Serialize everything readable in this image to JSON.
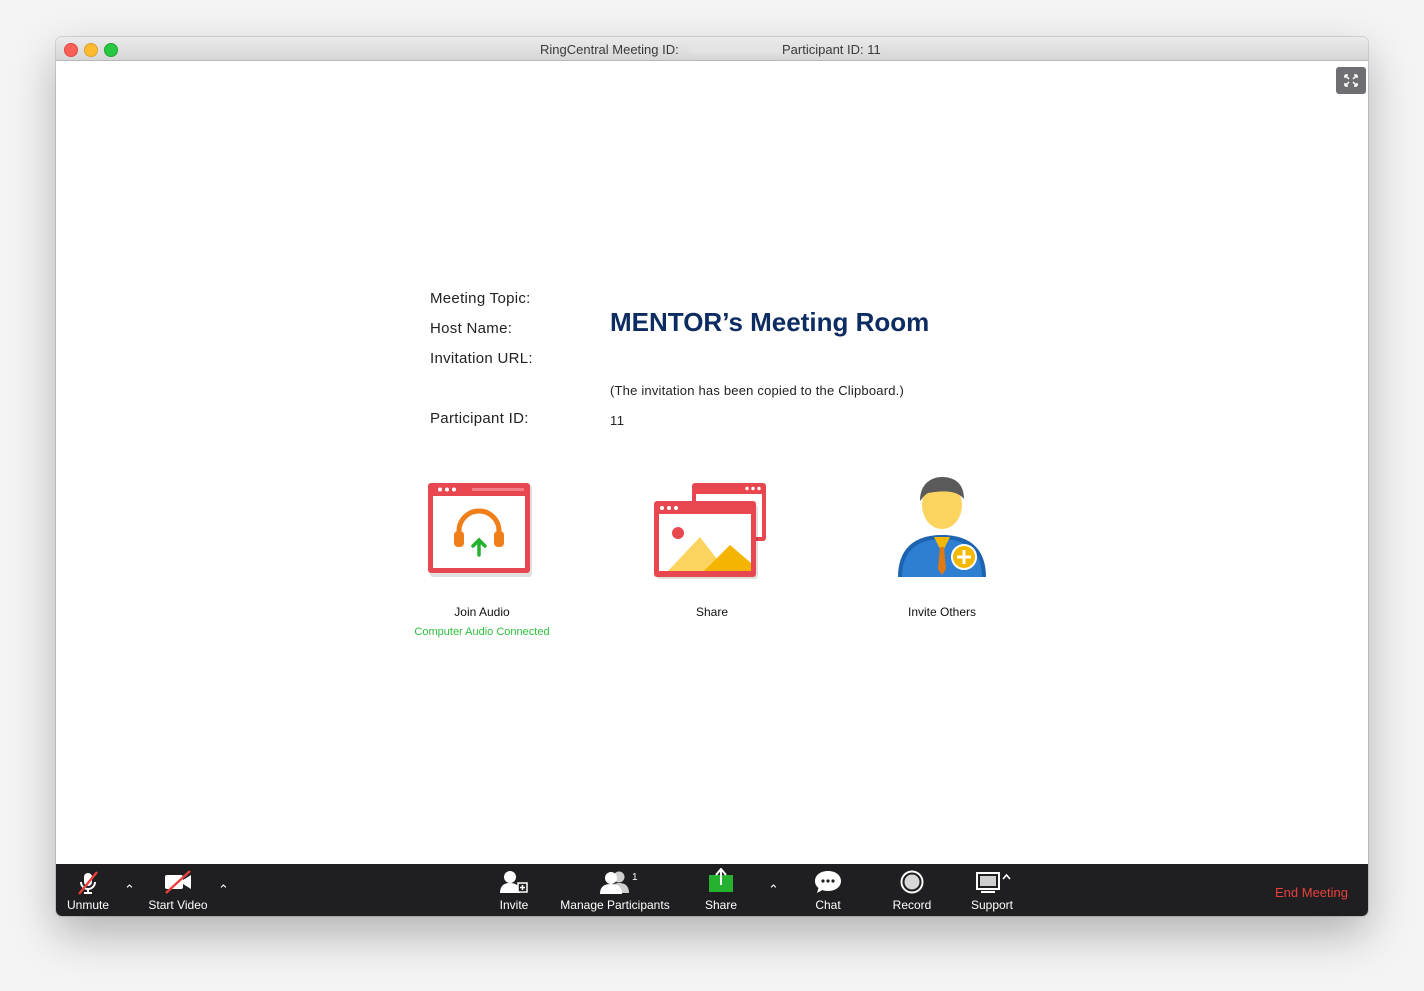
{
  "window": {
    "title_meeting_label": "RingCentral Meeting ID:",
    "title_participant_label": "Participant ID: 11"
  },
  "meeting_info": {
    "topic_label": "Meeting Topic:",
    "host_label": "Host Name:",
    "url_label": "Invitation URL:",
    "participant_label": "Participant ID:",
    "host_name": "MENTOR’s Meeting Room",
    "clipboard_note": "(The invitation has been copied to the Clipboard.)",
    "participant_id": "11"
  },
  "actions": {
    "join_audio": {
      "label": "Join Audio",
      "status": "Computer Audio Connected"
    },
    "share": {
      "label": "Share"
    },
    "invite_others": {
      "label": "Invite Others"
    }
  },
  "toolbar": {
    "unmute": "Unmute",
    "start_video": "Start Video",
    "invite": "Invite",
    "manage_participants": "Manage Participants",
    "participant_count": "1",
    "share": "Share",
    "chat": "Chat",
    "record": "Record",
    "support": "Support",
    "end_meeting": "End Meeting"
  },
  "colors": {
    "host_name": "#0d2d62",
    "audio_connected": "#2fbf3c",
    "end_meeting": "#e8403b",
    "share_green": "#25b230",
    "toolbar_bg": "#1f1f21"
  },
  "icons": {
    "unmute": "microphone-muted-icon",
    "start_video": "video-camera-off-icon",
    "invite": "add-person-icon",
    "manage_participants": "participants-icon",
    "share": "share-screen-icon",
    "chat": "chat-bubble-icon",
    "record": "record-icon",
    "support": "support-screen-icon"
  }
}
